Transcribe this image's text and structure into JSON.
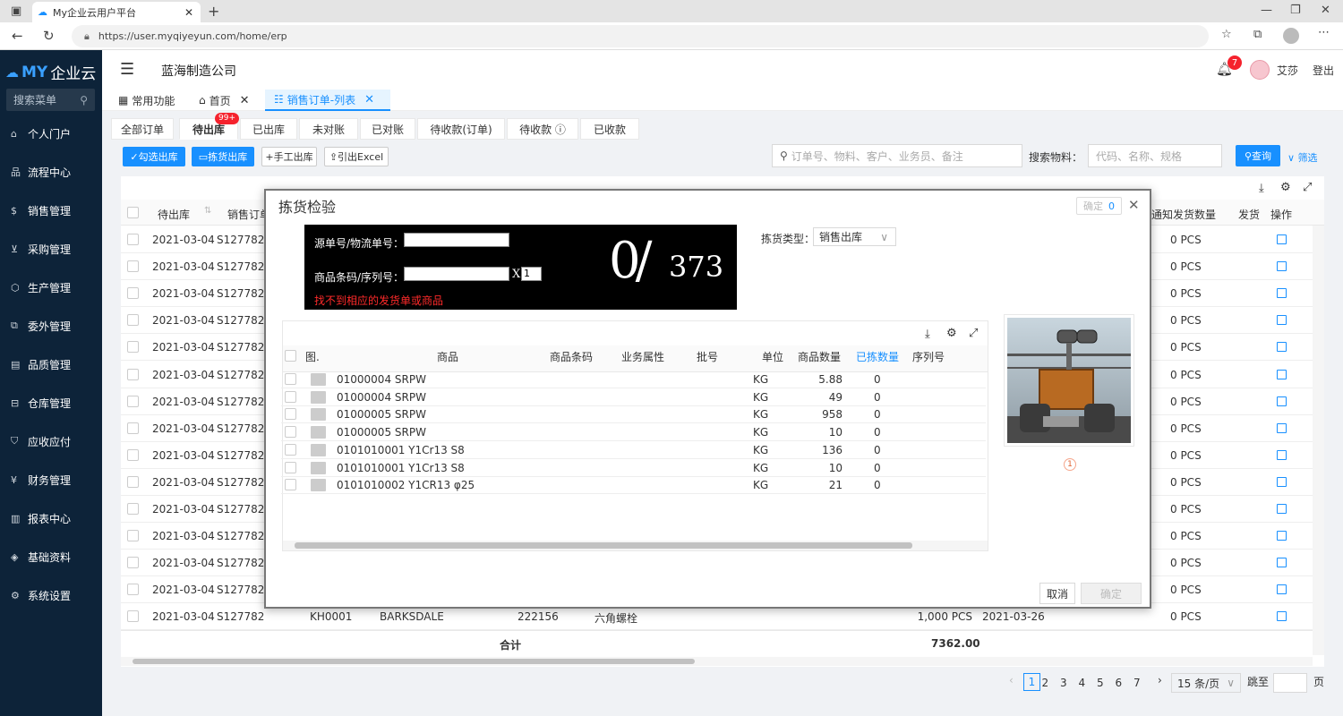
{
  "browser": {
    "tab_title": "My企业云用户平台",
    "url": "https://user.myqiyeyun.com/home/erp"
  },
  "sidebar": {
    "logo_my": "MY",
    "logo_text": "企业云",
    "search_label": "搜索菜单",
    "items": [
      {
        "label": "个人门户",
        "icon": "home-icon"
      },
      {
        "label": "流程中心",
        "icon": "flow-icon"
      },
      {
        "label": "销售管理",
        "icon": "dollar-icon"
      },
      {
        "label": "采购管理",
        "icon": "cart-icon"
      },
      {
        "label": "生产管理",
        "icon": "cube-icon"
      },
      {
        "label": "委外管理",
        "icon": "external-icon"
      },
      {
        "label": "品质管理",
        "icon": "quality-icon"
      },
      {
        "label": "仓库管理",
        "icon": "warehouse-icon"
      },
      {
        "label": "应收应付",
        "icon": "shield-icon"
      },
      {
        "label": "财务管理",
        "icon": "yen-icon"
      },
      {
        "label": "报表中心",
        "icon": "chart-icon"
      },
      {
        "label": "基础资料",
        "icon": "layers-icon"
      },
      {
        "label": "系统设置",
        "icon": "gear-icon"
      }
    ]
  },
  "header": {
    "company": "蓝海制造公司",
    "notif_count": "7",
    "user": "艾莎",
    "logout": "登出"
  },
  "navtabs": [
    {
      "label": "常用功能"
    },
    {
      "label": "首页"
    },
    {
      "label": "销售订单-列表"
    }
  ],
  "subtabs": [
    {
      "label": "全部订单"
    },
    {
      "label": "待出库",
      "badge": "99+"
    },
    {
      "label": "已出库"
    },
    {
      "label": "未对账"
    },
    {
      "label": "已对账"
    },
    {
      "label": "待收款(订单)"
    },
    {
      "label": "待收款 ⓘ"
    },
    {
      "label": "已收款"
    }
  ],
  "toolbar": {
    "select_out": "勾选出库",
    "pick_out": "拣货出库",
    "manual_out": "手工出库",
    "export_excel": "引出Excel",
    "search_placeholder": "订单号、物料、客户、业务员、备注",
    "material_label": "搜索物料：",
    "material_placeholder": "代码、名称、规格",
    "query": "查询",
    "filter": "筛选"
  },
  "grid": {
    "headers": {
      "out": "待出库",
      "order": "销售订单",
      "notify_qty": "通知发货数量",
      "ship": "发货",
      "ops": "操作"
    },
    "rows": [
      {
        "date": "2021-03-04",
        "order": "S127782",
        "qty": "0 PCS"
      },
      {
        "date": "2021-03-04",
        "order": "S127782",
        "qty": "0 PCS"
      },
      {
        "date": "2021-03-04",
        "order": "S127782",
        "qty": "0 PCS"
      },
      {
        "date": "2021-03-04",
        "order": "S127782",
        "qty": "0 PCS"
      },
      {
        "date": "2021-03-04",
        "order": "S127782",
        "qty": "0 PCS"
      },
      {
        "date": "2021-03-04",
        "order": "S127782",
        "qty": "0 PCS"
      },
      {
        "date": "2021-03-04",
        "order": "S127782",
        "qty": "0 PCS"
      },
      {
        "date": "2021-03-04",
        "order": "S127782",
        "qty": "0 PCS"
      },
      {
        "date": "2021-03-04",
        "order": "S127782",
        "qty": "0 PCS"
      },
      {
        "date": "2021-03-04",
        "order": "S127782",
        "qty": "0 PCS"
      },
      {
        "date": "2021-03-04",
        "order": "S127782",
        "qty": "0 PCS"
      },
      {
        "date": "2021-03-04",
        "order": "S127782",
        "qty": "0 PCS"
      },
      {
        "date": "2021-03-04",
        "order": "S127782",
        "qty": "0 PCS"
      },
      {
        "date": "2021-03-04",
        "order": "S127782",
        "qty": "0 PCS"
      },
      {
        "date": "2021-03-04",
        "order": "S127782",
        "customer_code": "KH0001",
        "customer": "BARKSDALE",
        "code": "222156",
        "product": "六角螺栓",
        "amount": "1,000 PCS",
        "ship_date": "2021-03-26",
        "qty": "0 PCS"
      }
    ],
    "total_label": "合计",
    "total_value": "7362.00"
  },
  "pagination": {
    "pages": [
      "1",
      "2",
      "3",
      "4",
      "5",
      "6",
      "7"
    ],
    "per_page": "15 条/页",
    "goto": "跳至",
    "page_unit": "页"
  },
  "modal": {
    "title": "拣货检验",
    "confirm_top": "确定",
    "confirm_count": "0",
    "source_label": "源单号/物流单号：",
    "barcode_label": "商品条码/序列号：",
    "multiplier": "X",
    "multiplier_value": "1",
    "error": "找不到相应的发货单或商品",
    "picked": "0/",
    "total": "373",
    "pick_type_label": "拣货类型：",
    "pick_type_value": "销售出库",
    "headers": {
      "img": "图.",
      "product": "商品",
      "barcode": "商品条码",
      "attr": "业务属性",
      "batch": "批号",
      "unit": "单位",
      "qty": "商品数量",
      "picked": "已拣数量",
      "serial": "序列号"
    },
    "rows": [
      {
        "product": "01000004 SRPW",
        "unit": "KG",
        "qty": "5.88",
        "picked": "0"
      },
      {
        "product": "01000004 SRPW",
        "unit": "KG",
        "qty": "49",
        "picked": "0"
      },
      {
        "product": "01000005 SRPW",
        "unit": "KG",
        "qty": "958",
        "picked": "0"
      },
      {
        "product": "01000005 SRPW",
        "unit": "KG",
        "qty": "10",
        "picked": "0"
      },
      {
        "product": "0101010001 Y1Cr13 S8",
        "unit": "KG",
        "qty": "136",
        "picked": "0"
      },
      {
        "product": "0101010001 Y1Cr13 S8",
        "unit": "KG",
        "qty": "10",
        "picked": "0"
      },
      {
        "product": "0101010002 Y1CR13 φ25",
        "unit": "KG",
        "qty": "21",
        "picked": "0"
      }
    ],
    "image_page": "1",
    "cancel": "取消",
    "confirm": "确定"
  },
  "colors": {
    "accent": "#1890ff",
    "sidebar": "#0d2339",
    "error": "#ff2a2a",
    "badge": "#f5222d"
  }
}
